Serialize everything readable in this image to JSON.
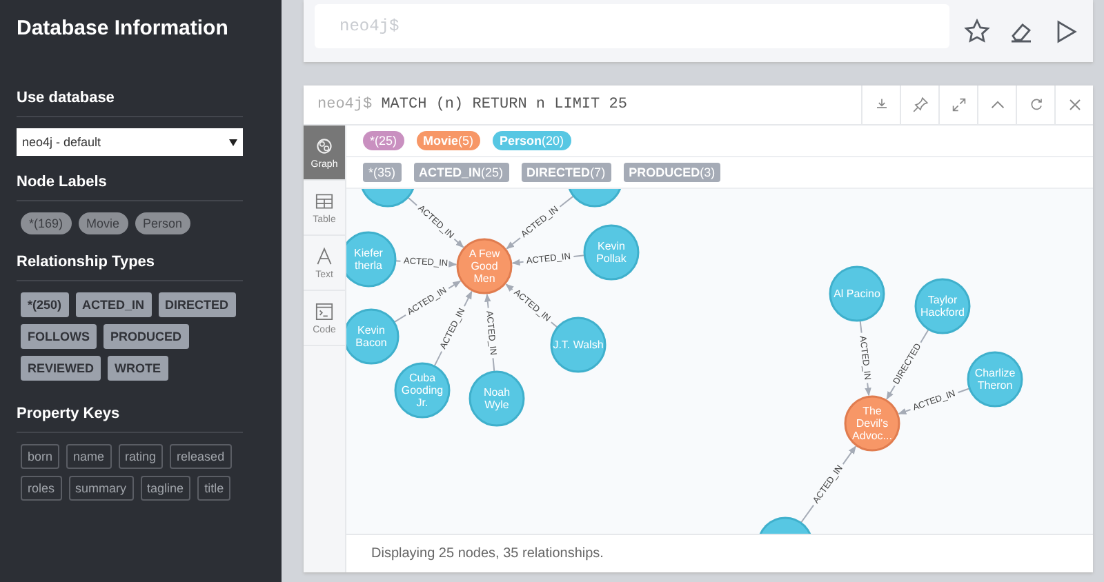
{
  "sidebar": {
    "title": "Database Information",
    "use_database": {
      "heading": "Use database",
      "value": "neo4j - default"
    },
    "node_labels": {
      "heading": "Node Labels",
      "items": [
        "*(169)",
        "Movie",
        "Person"
      ]
    },
    "relationship_types": {
      "heading": "Relationship Types",
      "items": [
        "*(250)",
        "ACTED_IN",
        "DIRECTED",
        "FOLLOWS",
        "PRODUCED",
        "REVIEWED",
        "WROTE"
      ]
    },
    "property_keys": {
      "heading": "Property Keys",
      "items": [
        "born",
        "name",
        "rating",
        "released",
        "roles",
        "summary",
        "tagline",
        "title"
      ]
    }
  },
  "editor": {
    "placeholder": "neo4j$"
  },
  "result": {
    "prompt": "neo4j$",
    "query": "MATCH (n) RETURN n LIMIT 25",
    "views": [
      {
        "label": "Graph",
        "selected": true
      },
      {
        "label": "Table",
        "selected": false
      },
      {
        "label": "Text",
        "selected": false
      },
      {
        "label": "Code",
        "selected": false
      }
    ],
    "node_legend": [
      {
        "text": "*(25)",
        "color": "#c990c0"
      },
      {
        "text": "**Movie**(5)",
        "color": "#f79767"
      },
      {
        "text": "**Person**(20)",
        "color": "#57c7e3"
      }
    ],
    "relationship_legend": [
      "*(35)",
      "**ACTED_IN**(25)",
      "**DIRECTED**(7)",
      "**PRODUCED**(3)"
    ],
    "graph": {
      "nodes": [
        {
          "kind": "person"
        },
        {
          "kind": "person"
        },
        {
          "kind": "person",
          "lines": [
            "Kiefer",
            "therla"
          ]
        },
        {
          "kind": "movie",
          "lines": [
            "A Few",
            "Good",
            "Men"
          ]
        },
        {
          "kind": "person",
          "lines": [
            "Kevin",
            "Pollak"
          ]
        },
        {
          "kind": "person",
          "lines": [
            "Al Pacino"
          ]
        },
        {
          "kind": "person",
          "lines": [
            "Taylor",
            "Hackford"
          ]
        },
        {
          "kind": "person",
          "lines": [
            "Kevin",
            "Bacon"
          ]
        },
        {
          "kind": "person",
          "lines": [
            "J.T. Walsh"
          ]
        },
        {
          "kind": "person",
          "lines": [
            "Cuba",
            "Gooding",
            "Jr."
          ]
        },
        {
          "kind": "person",
          "lines": [
            "Charlize",
            "Theron"
          ]
        },
        {
          "kind": "person",
          "lines": [
            "Noah",
            "Wyle"
          ]
        },
        {
          "kind": "movie",
          "lines": [
            "The",
            "Devil's",
            "Advoc..."
          ]
        },
        {
          "kind": "person"
        }
      ],
      "edges": [
        {
          "label": "ACTED_IN"
        },
        {
          "label": "ACTED_IN"
        },
        {
          "label": "ACTED_IN"
        },
        {
          "label": "ACTED_IN"
        },
        {
          "label": "ACTED_IN"
        },
        {
          "label": "ACTED_IN"
        },
        {
          "label": "ACTED_IN"
        },
        {
          "label": "ACTED_IN"
        },
        {
          "label": "ACTED_IN"
        },
        {
          "label": "DIRECTED"
        },
        {
          "label": "ACTED_IN"
        },
        {
          "label": "ACTED_IN"
        }
      ]
    },
    "status": "Displaying 25 nodes, 35 relationships."
  }
}
